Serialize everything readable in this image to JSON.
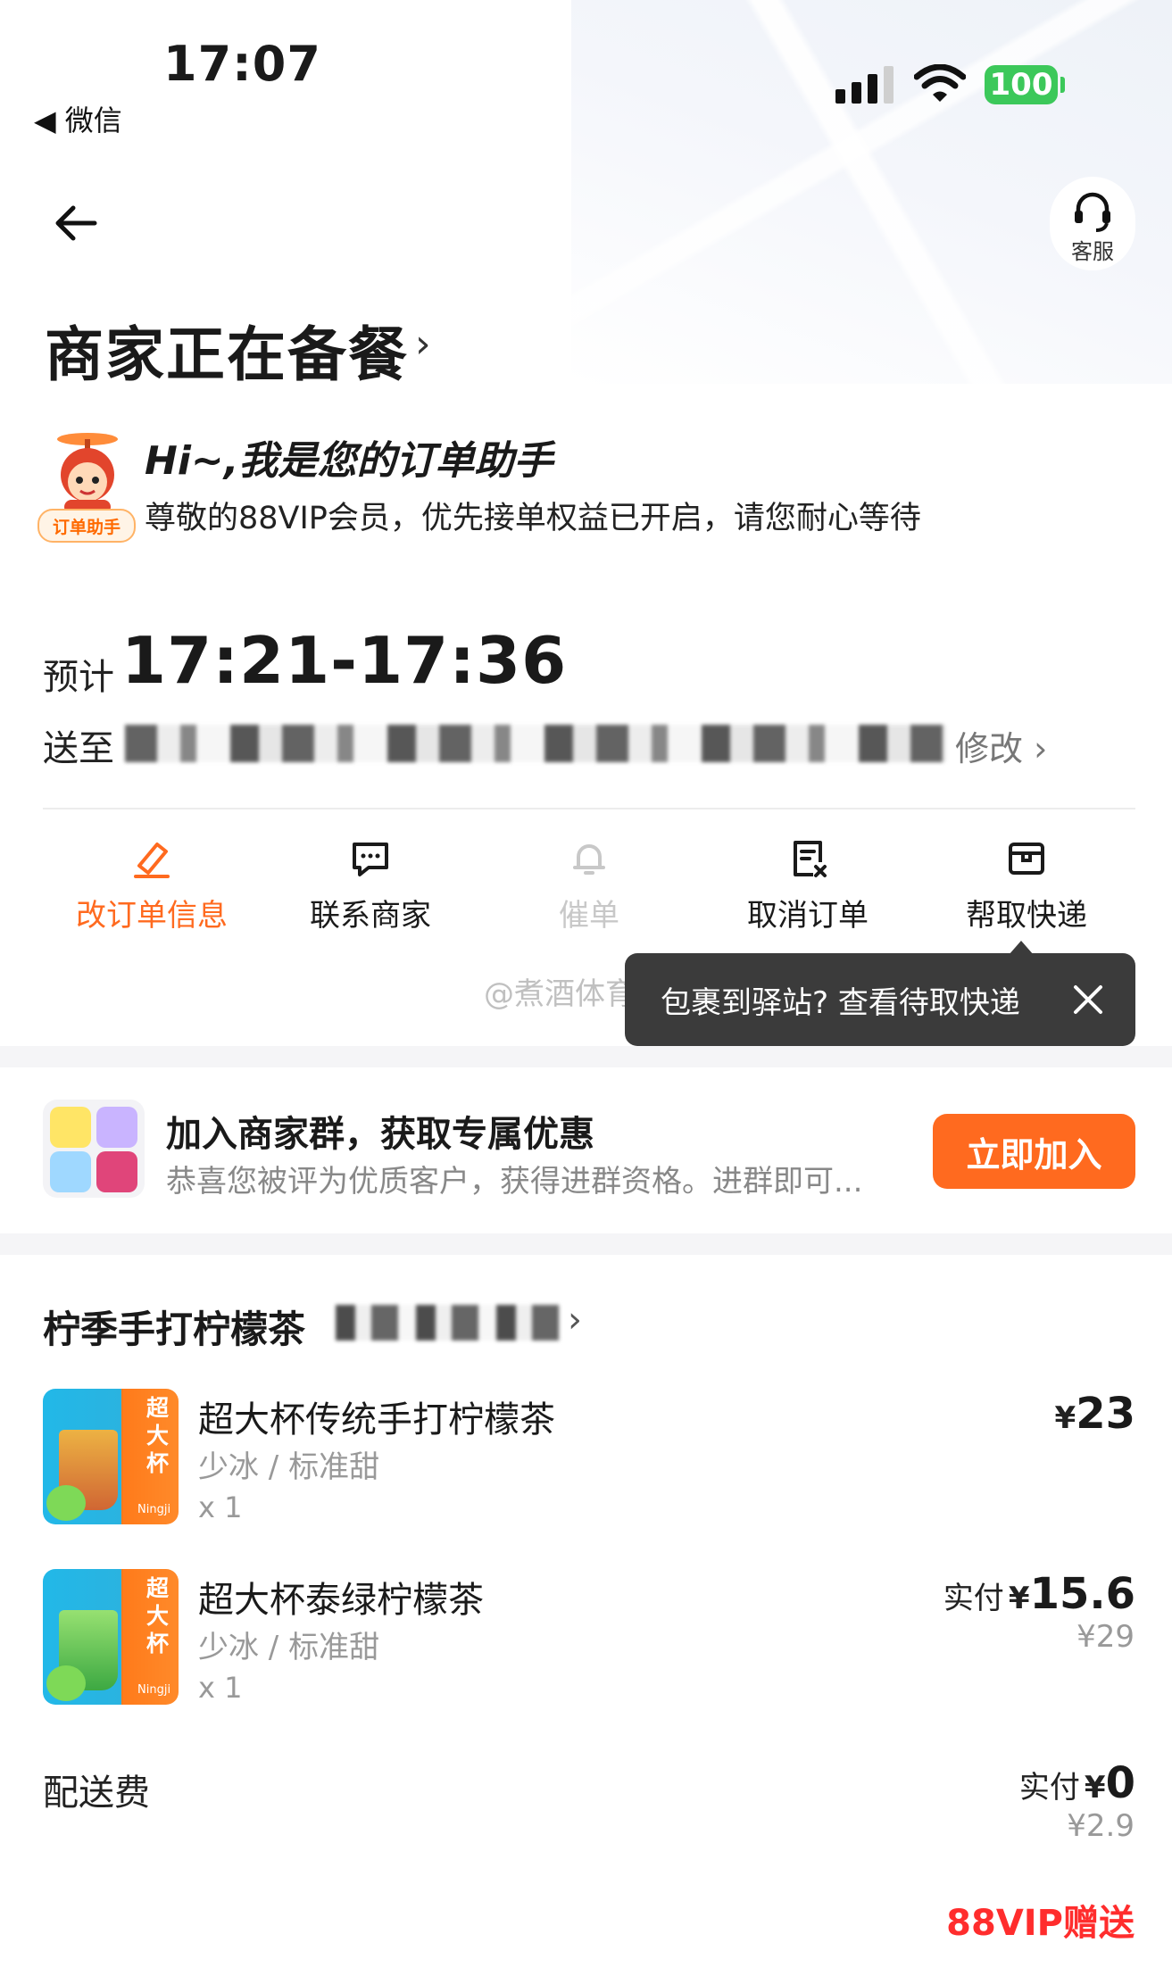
{
  "status_bar": {
    "time": "17:07",
    "back_app": "◀ 微信",
    "battery": "100"
  },
  "header": {
    "service_label": "客服"
  },
  "order": {
    "title": "商家正在备餐",
    "assistant_title": "Hi~,我是您的订单助手",
    "assistant_tag": "订单助手",
    "assistant_message": "尊敬的88VIP会员，优先接单权益已开启，请您耐心等待",
    "eta_label": "预计",
    "eta_time": "17:21-17:36",
    "address_label": "送至",
    "address_edit": "修改"
  },
  "actions": [
    {
      "label": "改订单信息",
      "icon": "pencil-icon",
      "color": "#ff6a1f"
    },
    {
      "label": "联系商家",
      "icon": "chat-icon",
      "color": "#1a1a1a"
    },
    {
      "label": "催单",
      "icon": "bell-icon",
      "color": "#c8c8c8"
    },
    {
      "label": "取消订单",
      "icon": "cancel-order-icon",
      "color": "#1a1a1a"
    },
    {
      "label": "帮取快递",
      "icon": "package-icon",
      "color": "#1a1a1a"
    }
  ],
  "tooltip": {
    "text": "包裹到驿站? 查看待取快递"
  },
  "watermark": "@煮酒体育",
  "group": {
    "title": "加入商家群，获取专属优惠",
    "subtitle": "恭喜您被评为优质客户，获得进群资格。进群即可...",
    "button": "立即加入"
  },
  "shop": {
    "name": "柠季手打柠檬茶"
  },
  "items": [
    {
      "name": "超大杯传统手打柠檬茶",
      "spec": "少冰 / 标准甜",
      "qty": "x 1",
      "price": "23",
      "currency": "¥"
    },
    {
      "name": "超大杯泰绿柠檬茶",
      "spec": "少冰 / 标准甜",
      "qty": "x 1",
      "paid_label": "实付",
      "currency": "¥",
      "price": "15.6",
      "original": "¥29"
    }
  ],
  "product_badge": {
    "line1": "超",
    "line2": "大",
    "line3": "杯",
    "brand": "Ningji"
  },
  "delivery": {
    "label": "配送费",
    "paid_label": "实付",
    "currency": "¥",
    "price": "0",
    "original": "¥2.9"
  },
  "vip_gift": "88VIP赠送",
  "colors": {
    "accent": "#ff6a1f",
    "vip_red": "#ff2d2d",
    "tooltip_bg": "#3b3b3b"
  }
}
